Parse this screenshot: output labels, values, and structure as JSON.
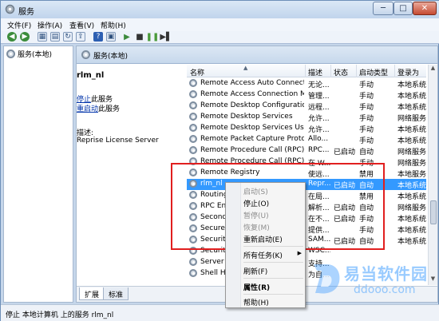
{
  "window": {
    "title": "服务",
    "min": "─",
    "max": "□",
    "close": "✕"
  },
  "menu": [
    "文件(F)",
    "操作(A)",
    "查看(V)",
    "帮助(H)"
  ],
  "toolbar": {
    "back": "◀",
    "forward": "▶",
    "play": "▶",
    "stop": "■",
    "pause": "❚❚",
    "restart": "▶▌"
  },
  "tree": {
    "node": "服务(本地)"
  },
  "header": {
    "title": "服务(本地)"
  },
  "desc": {
    "service_name": "rlm_nl",
    "stop_link": "停止",
    "stop_suffix": "此服务",
    "restart_link": "重启动",
    "restart_suffix": "此服务",
    "desc_label": "描述:",
    "desc_text": "Reprise License Server"
  },
  "table": {
    "columns": [
      "名称",
      "描述",
      "状态",
      "启动类型",
      "登录为"
    ],
    "rows": [
      [
        "Remote Access Auto Connectio...",
        "无论...",
        "",
        "手动",
        "本地系统"
      ],
      [
        "Remote Access Connection Ma...",
        "管理...",
        "",
        "手动",
        "本地系统"
      ],
      [
        "Remote Desktop Configuration",
        "远程...",
        "",
        "手动",
        "本地系统"
      ],
      [
        "Remote Desktop Services",
        "允许...",
        "",
        "手动",
        "网络服务"
      ],
      [
        "Remote Desktop Services User...",
        "允许...",
        "",
        "手动",
        "本地系统"
      ],
      [
        "Remote Packet Capture Protoc...",
        "Allo...",
        "",
        "手动",
        "本地系统"
      ],
      [
        "Remote Procedure Call (RPC)",
        "RPC...",
        "已启动",
        "自动",
        "网络服务"
      ],
      [
        "Remote Procedure Call (RPC) Lo...",
        "在 W...",
        "",
        "手动",
        "网络服务"
      ],
      [
        "Remote Registry",
        "使远...",
        "",
        "禁用",
        "本地服务"
      ],
      [
        "rlm_nl",
        "Repr...",
        "已启动",
        "自动",
        "本地系统"
      ],
      [
        "Routing",
        "在局...",
        "",
        "禁用",
        "本地系统"
      ],
      [
        "RPC End",
        "解析...",
        "已启动",
        "自动",
        "网络服务"
      ],
      [
        "Seconda",
        "在不...",
        "已启动",
        "手动",
        "本地系统"
      ],
      [
        "Secure S",
        "提供...",
        "",
        "手动",
        "本地系统"
      ],
      [
        "Security",
        "SAM...",
        "已启动",
        "自动",
        "本地系统"
      ],
      [
        "Security",
        "WSC...",
        "",
        "",
        ""
      ],
      [
        "Server",
        "支持...",
        "",
        "",
        ""
      ],
      [
        "Shell Ha",
        "为自...",
        "",
        "",
        ""
      ]
    ],
    "selected_index": 9
  },
  "tabs": [
    "扩展",
    "标准"
  ],
  "context_menu": {
    "items": [
      {
        "label": "启动(S)",
        "disabled": true
      },
      {
        "label": "停止(O)",
        "disabled": false
      },
      {
        "label": "暂停(U)",
        "disabled": true
      },
      {
        "label": "恢复(M)",
        "disabled": true
      },
      {
        "label": "重新启动(E)",
        "disabled": false
      },
      {
        "label": "所有任务(K)",
        "disabled": false,
        "submenu": "▶"
      },
      {
        "label": "刷新(F)",
        "disabled": false
      },
      {
        "label": "属性(R)",
        "disabled": false,
        "bold": true
      },
      {
        "label": "帮助(H)",
        "disabled": false
      }
    ]
  },
  "status": {
    "text": "停止 本地计算机 上的服务 rlm_nl"
  },
  "watermark": {
    "cn": "易当软件园",
    "en": "ddooo.com"
  },
  "colors": {
    "highlight": "#3399ff",
    "annotation": "#e11f1f",
    "link": "#0033aa"
  }
}
